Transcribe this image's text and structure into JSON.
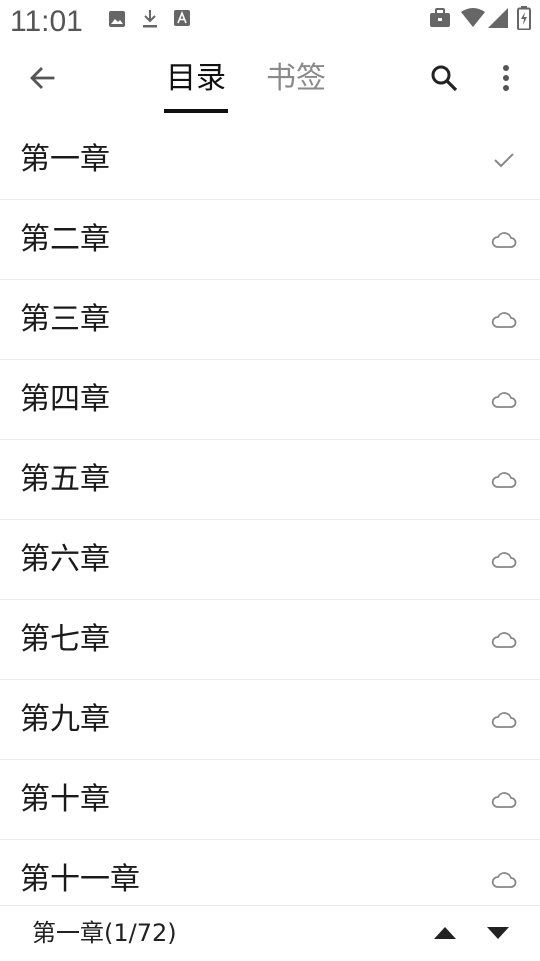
{
  "status_bar": {
    "time": "11:01",
    "left_icons": [
      "image-icon",
      "download-icon",
      "font-icon"
    ],
    "right_icons": [
      "briefcase-icon",
      "wifi-icon",
      "signal-icon",
      "battery-charging-icon"
    ]
  },
  "toolbar": {
    "back_icon": "back-arrow-icon",
    "tabs": [
      {
        "label": "目录",
        "selected": true
      },
      {
        "label": "书签",
        "selected": false
      }
    ],
    "search_icon": "search-icon",
    "more_icon": "more-vert-icon"
  },
  "chapters": [
    {
      "title": "第一章",
      "status": "downloaded"
    },
    {
      "title": "第二章",
      "status": "cloud"
    },
    {
      "title": "第三章",
      "status": "cloud"
    },
    {
      "title": "第四章",
      "status": "cloud"
    },
    {
      "title": "第五章",
      "status": "cloud"
    },
    {
      "title": "第六章",
      "status": "cloud"
    },
    {
      "title": "第七章",
      "status": "cloud"
    },
    {
      "title": "第九章",
      "status": "cloud"
    },
    {
      "title": "第十章",
      "status": "cloud"
    },
    {
      "title": "第十一章",
      "status": "cloud"
    }
  ],
  "bottom_bar": {
    "current_chapter": "第一章(1/72)",
    "up_icon": "triangle-up-icon",
    "down_icon": "triangle-down-icon"
  },
  "colors": {
    "text_primary": "#1a1a1a",
    "text_secondary": "#8a8a8a",
    "icon_gray": "#888888",
    "divider": "#ececec"
  }
}
